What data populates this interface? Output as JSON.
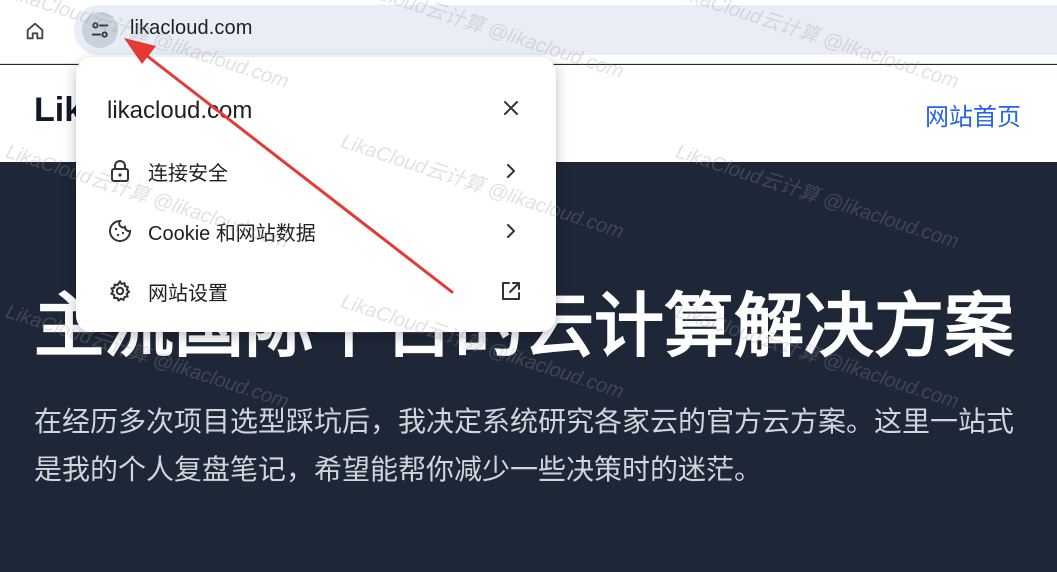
{
  "browser": {
    "url": "likacloud.com"
  },
  "page": {
    "brand": "Lik",
    "nav_home": "网站首页",
    "hero_title": "主流国际平台的云计算解决方案",
    "hero_desc_line1": "在经历多次项目选型踩坑后，我决定系统研究各家云的官方云方案。这里一站式",
    "hero_desc_line2": "是我的个人复盘笔记，希望能帮你减少一些决策时的迷茫。"
  },
  "popup": {
    "title": "likacloud.com",
    "items": [
      {
        "label": "连接安全",
        "icon": "lock-icon",
        "trail": "chevron-right-icon"
      },
      {
        "label": "Cookie 和网站数据",
        "icon": "cookie-icon",
        "trail": "chevron-right-icon"
      },
      {
        "label": "网站设置",
        "icon": "gear-icon",
        "trail": "external-link-icon"
      }
    ]
  },
  "watermark": {
    "text": "LikaCloud云计算 @likacloud.com"
  },
  "colors": {
    "accent": "#2563eb",
    "hero_bg": "#1e2738",
    "annotation": "#e53935"
  }
}
